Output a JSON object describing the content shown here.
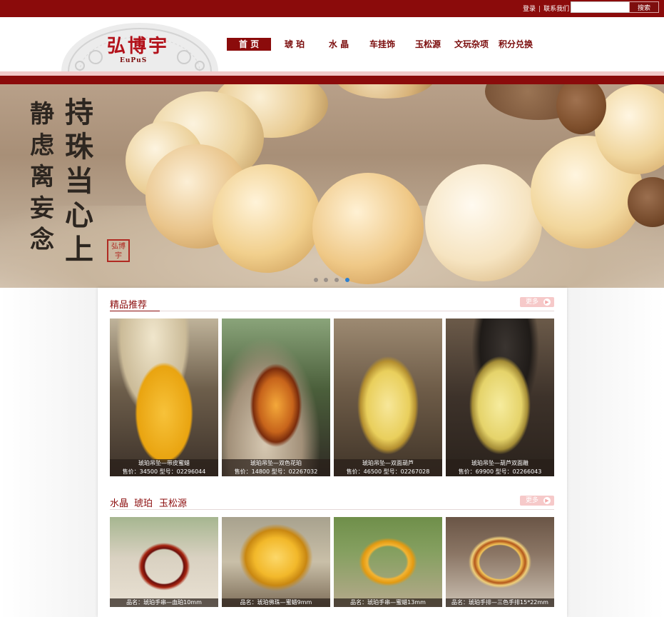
{
  "topbar": {
    "login": "登录",
    "separator": "|",
    "contact": "联系我们",
    "search_placeholder": "",
    "search_button": "搜索"
  },
  "logo": {
    "text": "弘博宇",
    "subtext": "EuPuS"
  },
  "nav": [
    {
      "label": "首 页",
      "active": true
    },
    {
      "label": "琥 珀"
    },
    {
      "label": "水 晶"
    },
    {
      "label": "车挂饰"
    },
    {
      "label": "玉松源"
    },
    {
      "label": "文玩杂项"
    },
    {
      "label": "积分兑换"
    }
  ],
  "banner": {
    "calligraphy_col1": "持珠当心上",
    "calligraphy_col2": "静虑离妄念",
    "seal": "弘博宇",
    "slide_count": 4,
    "active_slide": 4
  },
  "featured": {
    "title": "精品推荐",
    "more": "更多",
    "items": [
      {
        "name": "琥珀吊坠—带皮蜜蜡",
        "price_line": "售价：34500 型号：02296044"
      },
      {
        "name": "琥珀吊坠—双色花珀",
        "price_line": "售价：14800 型号：02267032"
      },
      {
        "name": "琥珀吊坠—双面葫芦",
        "price_line": "售价：46500 型号：02267028"
      },
      {
        "name": "琥珀吊坠—葫芦双面雕",
        "price_line": "售价：69900 型号：02266043"
      }
    ]
  },
  "category": {
    "tabs": [
      {
        "label": "水晶"
      },
      {
        "label": "琥珀",
        "active": true
      },
      {
        "label": "玉松源"
      }
    ],
    "more": "更多",
    "items": [
      {
        "name": "品名：琥珀手串—血珀10mm"
      },
      {
        "name": "品名：琥珀佛珠—蜜蜡9mm"
      },
      {
        "name": "品名：琥珀手串—蜜蜡13mm"
      },
      {
        "name": "品名：琥珀手排—三色手排15*22mm"
      }
    ]
  },
  "colors": {
    "brand_red": "#8b0b0b",
    "active_dot": "#2d7fd0"
  }
}
